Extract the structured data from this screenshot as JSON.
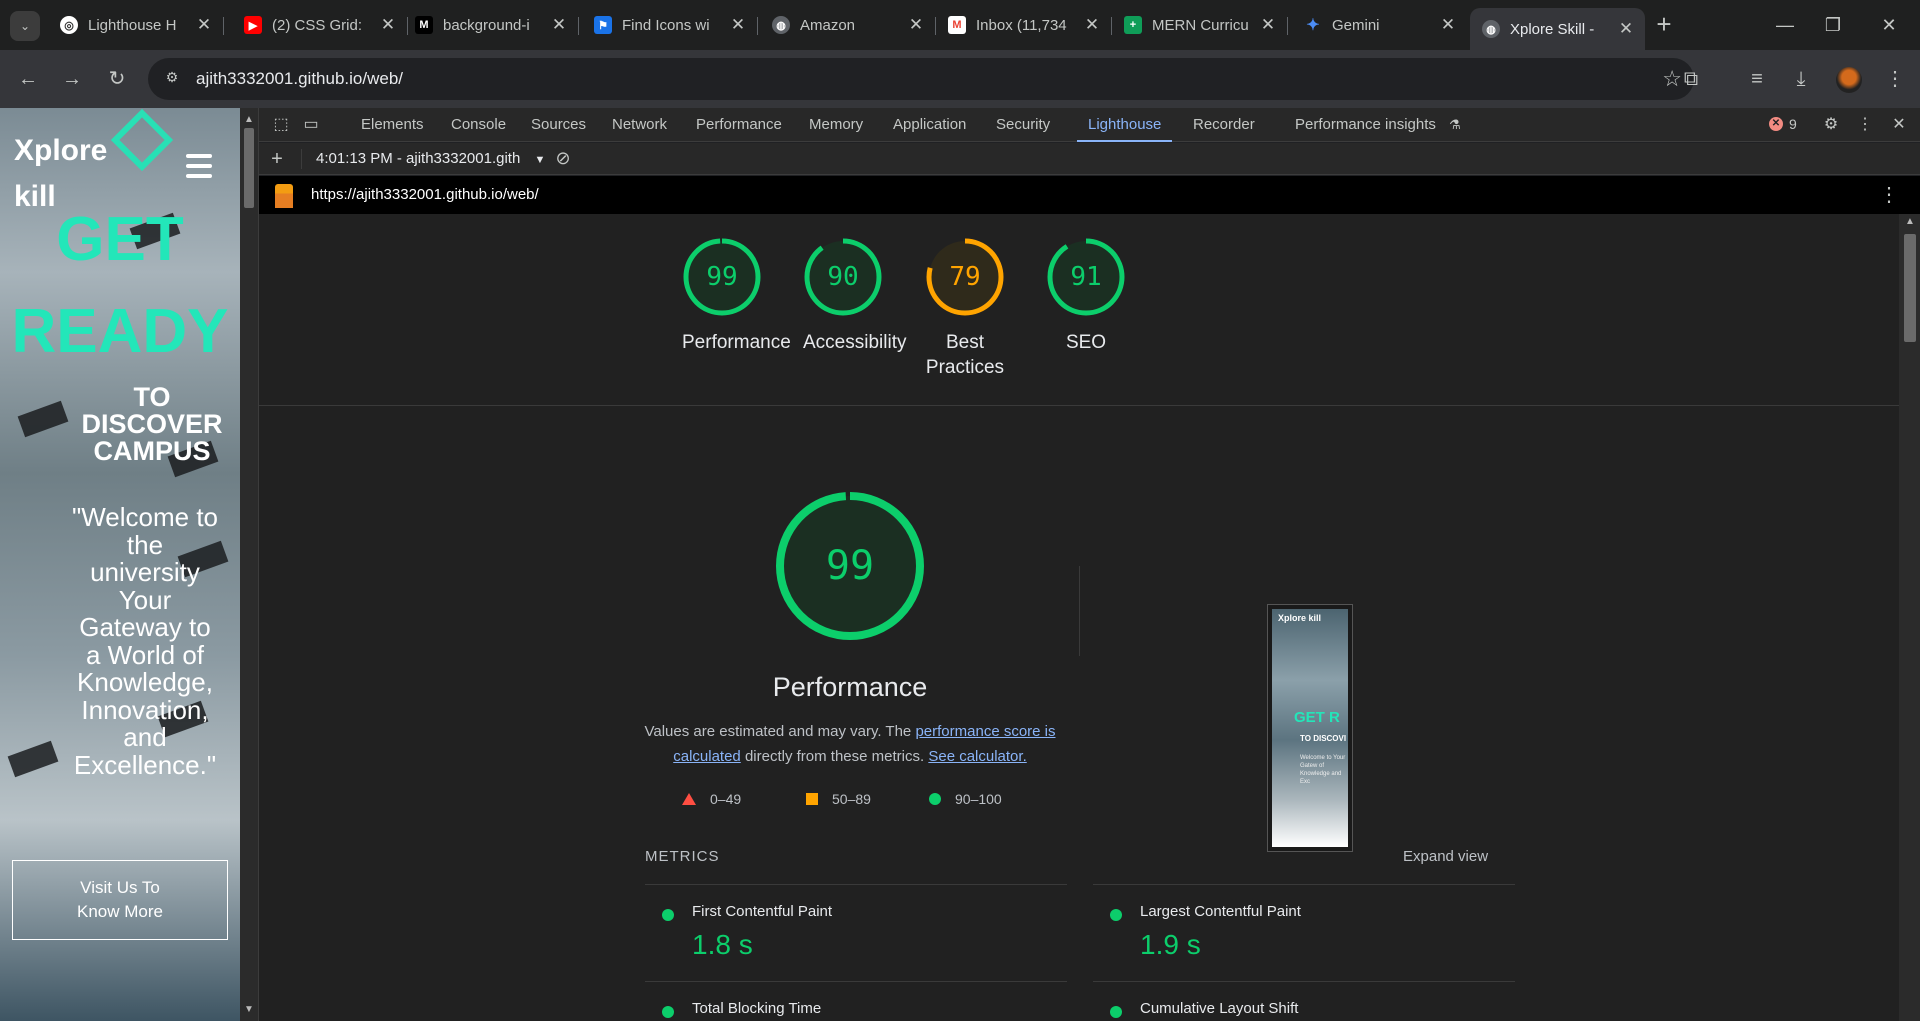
{
  "browser": {
    "tabs": [
      {
        "title": "Lighthouse H",
        "favicon": "lighthouse-icon"
      },
      {
        "title": "(2) CSS Grid: ",
        "favicon": "youtube-icon"
      },
      {
        "title": "background-i",
        "favicon": "medium-icon"
      },
      {
        "title": "Find Icons wi",
        "favicon": "flag-icon"
      },
      {
        "title": "Amazon",
        "favicon": "globe-icon"
      },
      {
        "title": "Inbox (11,734",
        "favicon": "gmail-icon"
      },
      {
        "title": "MERN Curricu",
        "favicon": "sheets-icon"
      },
      {
        "title": "Gemini",
        "favicon": "gemini-icon"
      },
      {
        "title": "Xplore Skill -",
        "favicon": "globe-icon",
        "active": true
      }
    ],
    "url": "ajith3332001.github.io/web/"
  },
  "site": {
    "logo_text_1": "Xplore",
    "logo_text_2": "kill",
    "h1_line1": "GET",
    "h1_line2": "READY",
    "h2": "TO DISCOVER CAMPUS",
    "quote": "\"Welcome to the university Your Gateway to a World of Knowledge, Innovation, and Excellence.\"",
    "button": "Visit Us To Know More",
    "accent_color": "#23e6b9"
  },
  "devtools": {
    "tabs": [
      "Elements",
      "Console",
      "Sources",
      "Network",
      "Performance",
      "Memory",
      "Application",
      "Security",
      "Lighthouse",
      "Recorder",
      "Performance insights"
    ],
    "active_tab": "Lighthouse",
    "error_count": "9",
    "report_selector": "4:01:13 PM - ajith3332001.gith",
    "report_url": "https://ajith3332001.github.io/web/"
  },
  "lighthouse": {
    "scores": [
      {
        "label": "Performance",
        "value": 99,
        "color": "#0cce6b"
      },
      {
        "label": "Accessibility",
        "value": 90,
        "color": "#0cce6b"
      },
      {
        "label": "Best Practices",
        "value": 79,
        "color": "#ffa400"
      },
      {
        "label": "SEO",
        "value": 91,
        "color": "#0cce6b"
      }
    ],
    "performance": {
      "score": 99,
      "title": "Performance",
      "desc_1": "Values are estimated and may vary. The",
      "desc_link_1": "performance score is calculated",
      "desc_2": "directly from these metrics.",
      "desc_link_2": "See calculator.",
      "legend": [
        "0–49",
        "50–89",
        "90–100"
      ]
    },
    "metrics_header": "METRICS",
    "expand_label": "Expand view",
    "metrics": [
      {
        "name": "First Contentful Paint",
        "value": "1.8 s"
      },
      {
        "name": "Largest Contentful Paint",
        "value": "1.9 s"
      },
      {
        "name": "Total Blocking Time",
        "value": ""
      },
      {
        "name": "Cumulative Layout Shift",
        "value": ""
      }
    ],
    "thumbnail": {
      "logo": "Xplore kill",
      "headline": "GET R",
      "sub": "TO DISCOVI",
      "body": "Welcome to Your Gatew of Knowledge and Exc"
    }
  }
}
